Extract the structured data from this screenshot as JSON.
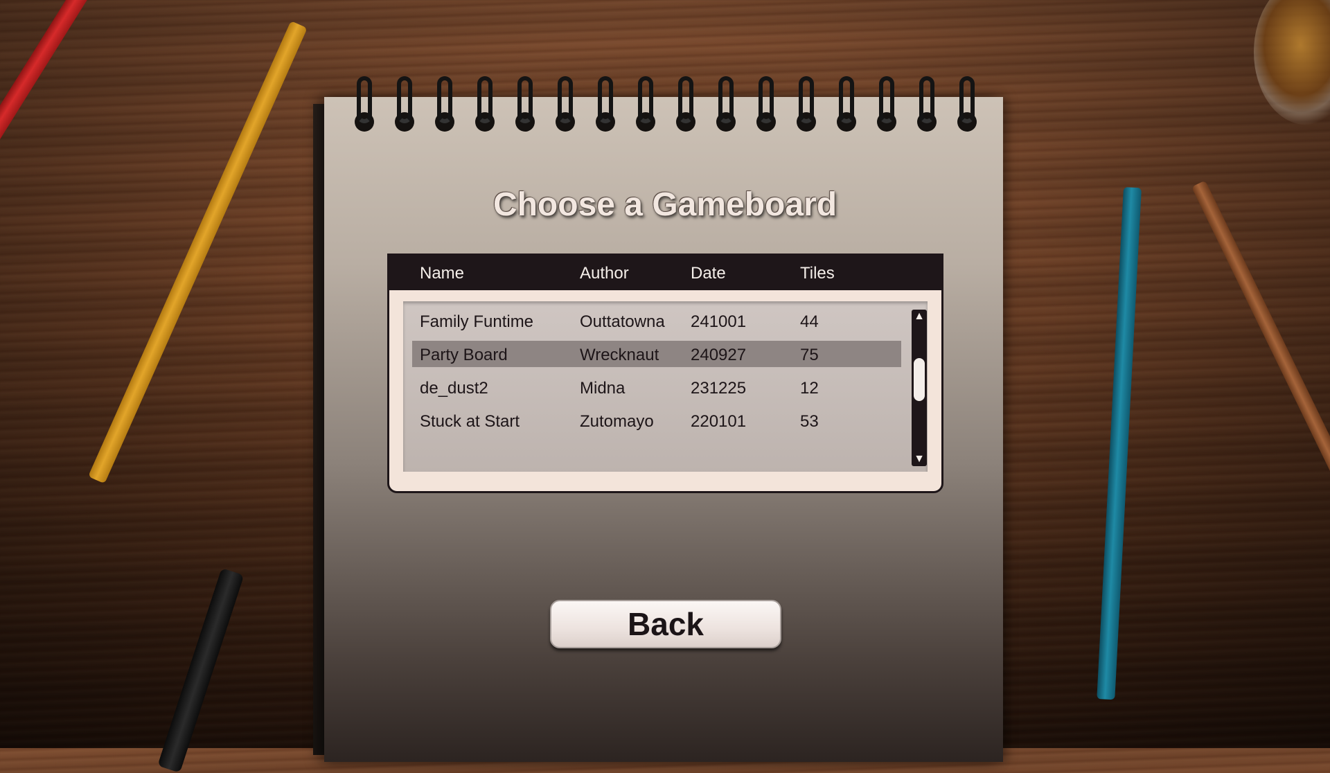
{
  "title": "Choose a Gameboard",
  "table": {
    "columns": [
      "Name",
      "Author",
      "Date",
      "Tiles"
    ],
    "rows": [
      {
        "name": "Family Funtime",
        "author": "Outtatowna",
        "date": "241001",
        "tiles": "44"
      },
      {
        "name": "Party Board",
        "author": "Wrecknaut",
        "date": "240927",
        "tiles": "75",
        "selected": true
      },
      {
        "name": "de_dust2",
        "author": "Midna",
        "date": "231225",
        "tiles": "12"
      },
      {
        "name": "Stuck at Start",
        "author": "Zutomayo",
        "date": "220101",
        "tiles": "53"
      }
    ],
    "scroll_up_icon": "triangle-up-icon",
    "scroll_down_icon": "triangle-down-icon"
  },
  "back_label": "Back",
  "colors": {
    "panel_dark": "#1e1619",
    "panel_light": "#f3e4da",
    "selection": "#8e8583"
  }
}
